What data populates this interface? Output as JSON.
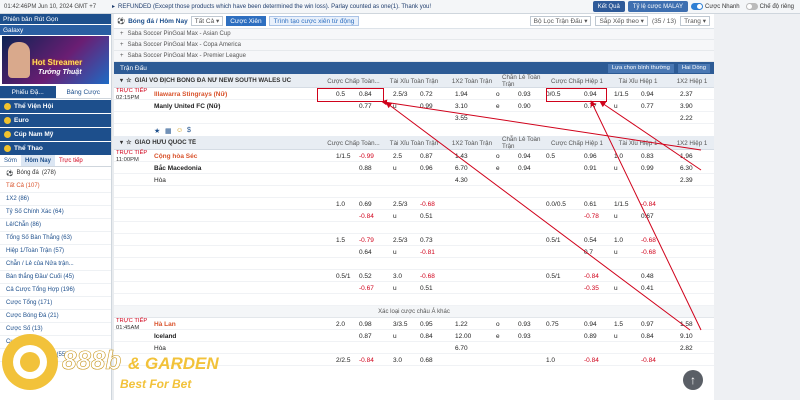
{
  "topbar": {
    "clock": "01:42:46PM Jun 10, 2024 GMT +7",
    "ticker": "REFUNDED (Except those products which have been determined the win loss). Parlay counted as one(1). Thank you!",
    "btn_result": "Kết Quả",
    "btn_odds": "Tỷ lệ cược MALAY",
    "toggle_quick": "Cược Nhanh",
    "toggle_easy": "Chế độ riêng"
  },
  "sidebar": {
    "item_top": "Phiên bản Rút Gọn",
    "item_galaxy": "Galaxy",
    "banner_line1": "Hot Streamer",
    "banner_line2": "Tướng Thuật",
    "tabs": [
      "Phiếu Đặ...",
      "Bảng Cược"
    ],
    "sections": [
      "Thể Viện Hội",
      "Euro",
      "Cúp Nam Mỹ",
      "Thể Thao"
    ],
    "subtabs": [
      "Sớm",
      "Hôm Nay",
      "Trực tiếp"
    ],
    "sport": "Bóng đá",
    "sport_count": "(278)",
    "items": [
      "Tất Cả (107)",
      "1X2 (86)",
      "Tỷ Số Chính Xác (64)",
      "Lẻ/Chẵn (86)",
      "Tổng Số Bàn Thắng (63)",
      "Hiệp 1/Toàn Trận (57)",
      "Chẵn / Lẻ của Nửa trận...",
      "Bàn thắng Đầu/ Cuối (45)",
      "Cả Cược Tổng Hợp (196)",
      "Cược Tổng (171)",
      "Cược Bóng Đá (21)",
      "Cược Số (13)",
      "Cược (12)",
      "Thể Thao Điện Tử (55)"
    ]
  },
  "filters": {
    "breadcrumb": "Bóng đá / Hôm Nay",
    "sel_all": "Tất Cả",
    "btn_parlay": "Cược Xiên",
    "btn_live": "Trình tạo cược xiên từ động",
    "filter_league": "Bộ Lọc Trận Đấu",
    "sort_label": "Sắp Xếp theo",
    "count": "(35 / 13)",
    "page": "Trang"
  },
  "collapsed": [
    "Saba Soccer PinGoal Max - Asian Cup",
    "Saba Soccer PinGoal Max - Copa America",
    "Saba Soccer PinGoal Max - Premier League"
  ],
  "header": {
    "left": "Trận Đấu",
    "right1": "Lựa chọn bình thường",
    "right2": "Hai Dòng"
  },
  "columns": [
    "Cược Chấp Toàn...",
    "Tài Xỉu Toàn Trận",
    "1X2 Toàn Trận",
    "Chẵn Lẻ Toàn Trận",
    "Cược Chấp Hiệp 1",
    "Tài Xỉu Hiệp 1",
    "1X2 Hiệp 1"
  ],
  "league1": {
    "name": "GIẢI VÔ ĐỊCH BÓNG ĐÁ NỮ NEW SOUTH WALES ÚC",
    "live": "TRỰC TIẾP",
    "time": "02:15PM",
    "home": "Illawarra Stingrays (Nữ)",
    "away": "Manly United FC (Nữ)",
    "rows": [
      [
        "0.5",
        "0.84",
        "2.5/3",
        "0.72",
        "1.94",
        "o",
        "0.93",
        "0/0.5",
        "0.94",
        "1/1.5",
        "0.94",
        "2.37"
      ],
      [
        "",
        "0.77",
        "u",
        "0.99",
        "3.10",
        "e",
        "0.90",
        "",
        "0.77",
        "u",
        "0.77",
        "3.90"
      ],
      [
        "",
        "",
        "",
        "",
        "3.55",
        "",
        "",
        "",
        "",
        "",
        "",
        "2.22"
      ]
    ]
  },
  "league2": {
    "name": "GIAO HỮU QUỐC TẾ",
    "live": "TRỰC TIẾP",
    "time": "11:00PM",
    "home": "Cộng hòa Séc",
    "away": "Bắc Macedonia",
    "draw": "Hòa",
    "rows": [
      [
        "1/1.5",
        "-0.99",
        "2.5",
        "0.87",
        "1.43",
        "o",
        "0.94",
        "0.5",
        "0.96",
        "1.0",
        "0.83",
        "1.96"
      ],
      [
        "",
        "0.88",
        "u",
        "0.96",
        "6.70",
        "e",
        "0.94",
        "",
        "0.91",
        "u",
        "0.99",
        "6.30"
      ],
      [
        "",
        "",
        "",
        "",
        "4.30",
        "",
        "",
        "",
        "",
        "",
        "",
        "2.39"
      ]
    ],
    "extra": [
      [
        "1.0",
        "0.69",
        "2.5/3",
        "-0.68",
        "",
        "",
        "",
        "0.0/0.5",
        "0.61",
        "1/1.5",
        "-0.84",
        ""
      ],
      [
        "",
        "-0.84",
        "u",
        "0.51",
        "",
        "",
        "",
        "",
        "-0.78",
        "u",
        "0.67",
        ""
      ],
      [
        "1.5",
        "-0.79",
        "2.5/3",
        "0.73",
        "",
        "",
        "",
        "0.5/1",
        "0.54",
        "1.0",
        "-0.68",
        ""
      ],
      [
        "",
        "0.64",
        "u",
        "-0.81",
        "",
        "",
        "",
        "",
        "0.7",
        "u",
        "-0.68",
        ""
      ],
      [
        "0.5/1",
        "0.52",
        "3.0",
        "-0.68",
        "",
        "",
        "",
        "0.5/1",
        "-0.84",
        "",
        "0.48",
        ""
      ],
      [
        "",
        "-0.67",
        "u",
        "0.51",
        "",
        "",
        "",
        "",
        "-0.35",
        "u",
        "0.41",
        ""
      ]
    ],
    "more": "Xác loại cược châu Á khác"
  },
  "league3": {
    "live": "TRỰC TIẾP",
    "time": "01:45AM",
    "home": "Hà Lan",
    "away": "Iceland",
    "draw": "Hòa",
    "rows": [
      [
        "2.0",
        "0.98",
        "3/3.5",
        "0.95",
        "1.22",
        "o",
        "0.93",
        "0.75",
        "0.94",
        "1.5",
        "0.97",
        "1.58"
      ],
      [
        "",
        "0.87",
        "u",
        "0.84",
        "12.00",
        "e",
        "0.93",
        "",
        "0.89",
        "u",
        "0.84",
        "9.10"
      ],
      [
        "",
        "",
        "",
        "",
        "6.70",
        "",
        "",
        "",
        "",
        "",
        "",
        "2.82"
      ],
      [
        "2/2.5",
        "-0.84",
        "3.0",
        "0.68",
        "",
        "",
        "",
        "1.0",
        "-0.84",
        "",
        "-0.84",
        ""
      ]
    ]
  },
  "logo": {
    "brand": "888b",
    "suffix": "& GARDEN",
    "tagline": "Best For Bet"
  }
}
